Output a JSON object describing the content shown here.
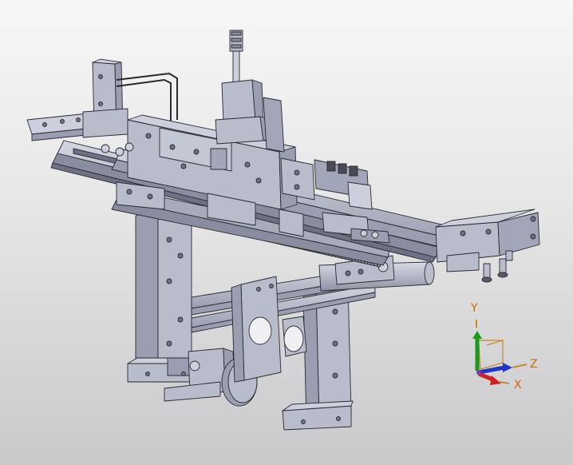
{
  "viewport": {
    "model": "cad-assembly-3d-model",
    "colors": {
      "background_top": "#f7f7f7",
      "background_bottom": "#c9c9cc",
      "part_face": "#b9bccb",
      "part_face_light": "#cdd0dc",
      "part_face_dark": "#9b9eb0",
      "edge": "#2a2a30"
    }
  },
  "triad": {
    "labels": {
      "y": "Y",
      "z": "Z",
      "x": "X"
    },
    "colors": {
      "y_axis": "#1a9a1a",
      "z_axis": "#1f35c8",
      "x_axis": "#d02020",
      "label": "#c86a00",
      "frame": "#c88a30"
    }
  }
}
